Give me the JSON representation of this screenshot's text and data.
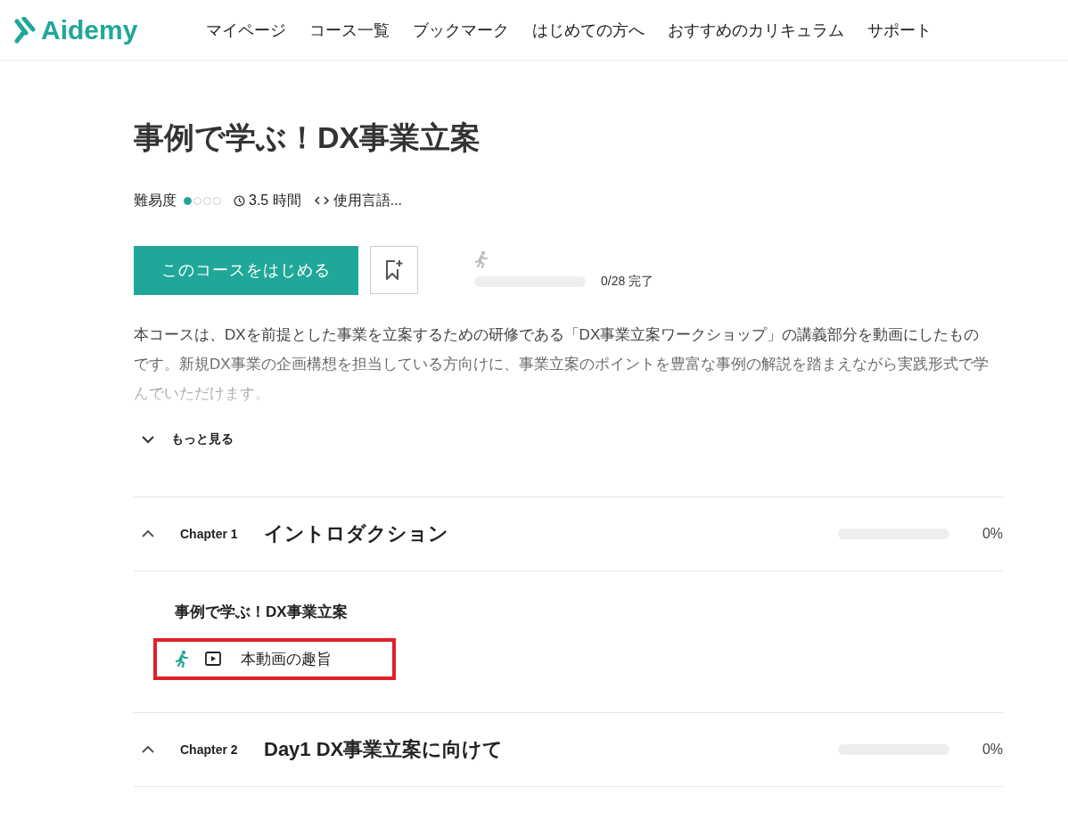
{
  "header": {
    "logo": "Aidemy",
    "nav": [
      "マイページ",
      "コース一覧",
      "ブックマーク",
      "はじめての方へ",
      "おすすめのカリキュラム",
      "サポート"
    ]
  },
  "course": {
    "title": "事例で学ぶ！DX事業立案",
    "meta": {
      "difficulty_label": "難易度",
      "difficulty_dots": [
        {
          "filled": true
        },
        {
          "filled": false
        },
        {
          "filled": false
        },
        {
          "filled": false
        }
      ],
      "duration": "3.5 時間",
      "languages": "使用言語..."
    },
    "start_button": "このコースをはじめる",
    "progress": {
      "level": 0,
      "text": "0/28 完了"
    },
    "description": "本コースは、DXを前提とした事業を立案するための研修である「DX事業立案ワークショップ」の講義部分を動画にしたものです。新規DX事業の企画構想を担当している方向けに、事業立案のポイントを豊富な事例の解説を踏まえながら実践形式で学んでいただけます。",
    "more": "もっと見る"
  },
  "chapters": [
    {
      "number": "Chapter 1",
      "title": "イントロダクション",
      "expanded": true,
      "level": 0,
      "percent": "0%",
      "sections": [
        {
          "title": "事例で学ぶ！DX事業立案",
          "lessons": [
            {
              "title": "本動画の趣旨",
              "highlighted": true
            }
          ]
        }
      ]
    },
    {
      "number": "Chapter 2",
      "title": "Day1 DX事業立案に向けて",
      "expanded": true,
      "level": 0,
      "percent": "0%"
    }
  ]
}
